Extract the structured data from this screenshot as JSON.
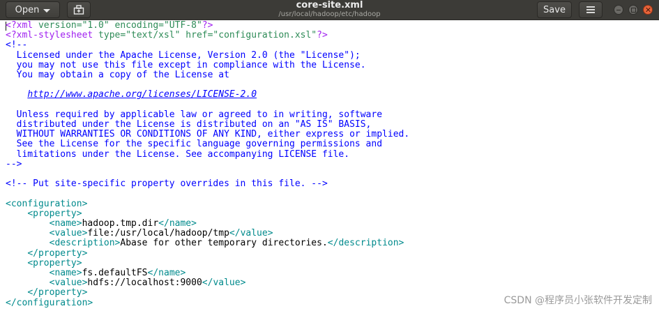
{
  "header": {
    "open_label": "Open",
    "save_label": "Save",
    "title": "core-site.xml",
    "subtitle": "/usr/local/hadoop/etc/hadoop",
    "icons": {
      "new_document": "new-document-icon",
      "menu": "hamburger-menu-icon",
      "dropdown": "chevron-down-icon"
    },
    "colors": {
      "bar": "#3c3b37",
      "close": "#e8643a"
    }
  },
  "code": {
    "xml_decl_open": "<?xml",
    "xml_decl_attrs": " version=\"1.0\" encoding=\"UTF-8\"",
    "xml_decl_close": "?>",
    "stylesheet_open": "<?xml-stylesheet",
    "stylesheet_attrs": " type=\"text/xsl\" href=\"configuration.xsl\"",
    "stylesheet_close": "?>",
    "comment_open": "<!--",
    "license_lines": [
      "  Licensed under the Apache License, Version 2.0 (the \"License\");",
      "  you may not use this file except in compliance with the License.",
      "  You may obtain a copy of the License at",
      ""
    ],
    "license_url_indent": "    ",
    "license_url": "http://www.apache.org/licenses/LICENSE-2.0",
    "license_lines_2": [
      "",
      "  Unless required by applicable law or agreed to in writing, software",
      "  distributed under the License is distributed on an \"AS IS\" BASIS,",
      "  WITHOUT WARRANTIES OR CONDITIONS OF ANY KIND, either express or implied.",
      "  See the License for the specific language governing permissions and",
      "  limitations under the License. See accompanying LICENSE file."
    ],
    "comment_close": "-->",
    "site_comment": "<!-- Put site-specific property overrides in this file. -->",
    "configuration_open": "<configuration>",
    "configuration_close": "</configuration>",
    "properties": [
      {
        "name": "hadoop.tmp.dir",
        "value": "file:/usr/local/hadoop/tmp",
        "description": "Abase for other temporary directories."
      },
      {
        "name": "fs.defaultFS",
        "value": "hdfs://localhost:9000"
      }
    ]
  },
  "watermark": "CSDN @程序员小张软件开发定制"
}
